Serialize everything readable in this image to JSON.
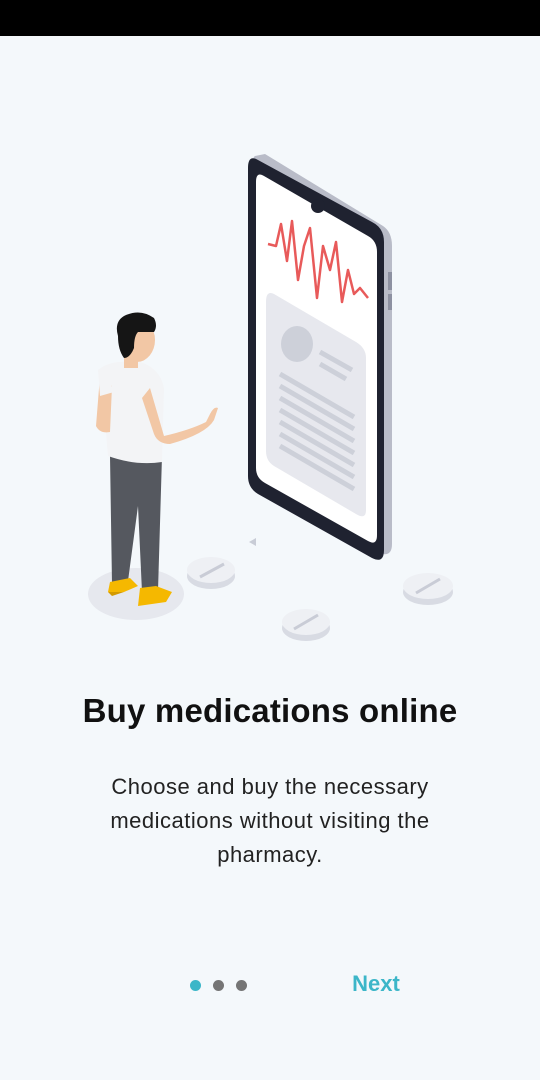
{
  "onboarding": {
    "title": "Buy medications online",
    "description": "Choose and buy the necessary medications without visiting the pharmacy.",
    "next_label": "Next",
    "pages": 3,
    "current_page": 1
  },
  "colors": {
    "background": "#f4f8fb",
    "accent": "#3cb6c8",
    "dot_inactive": "#757575",
    "heartbeat": "#e85a5a",
    "shoes": "#f5b800"
  }
}
